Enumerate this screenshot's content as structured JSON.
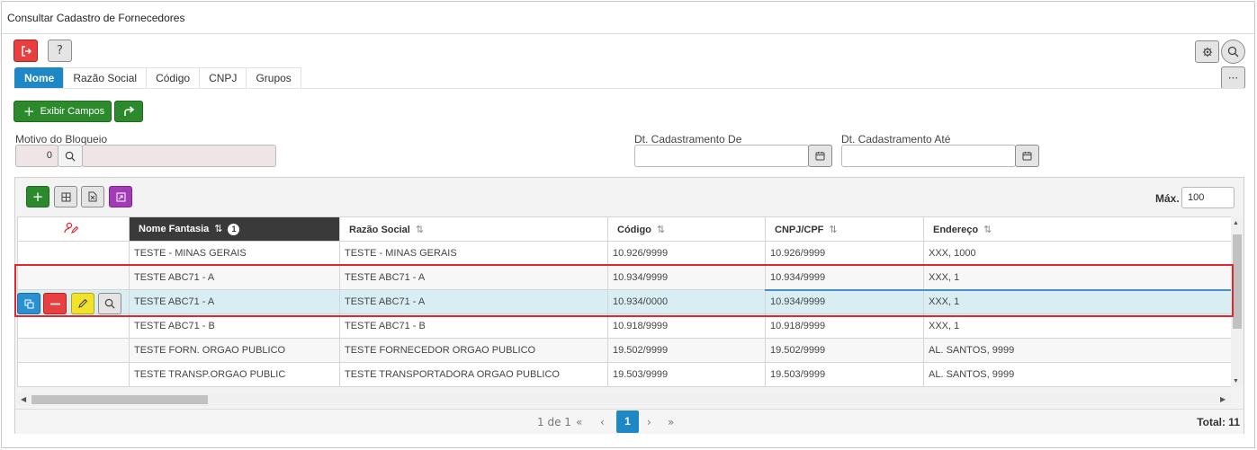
{
  "window": {
    "title": "Consultar Cadastro de Fornecedores"
  },
  "toolbar": {
    "exit_icon": "exit-icon",
    "help_label": "?",
    "settings_icon": "gear-icon",
    "search_icon": "search-icon",
    "more_label": "···"
  },
  "tabs": [
    {
      "label": "Nome",
      "active": true
    },
    {
      "label": "Razão Social"
    },
    {
      "label": "Código"
    },
    {
      "label": "CNPJ"
    },
    {
      "label": "Grupos"
    }
  ],
  "actions": {
    "show_fields_label": "Exibir Campos",
    "plus": "+",
    "share_icon": "share-icon"
  },
  "filters": {
    "motivo_label": "Motivo do Bloqueio",
    "motivo_code": "0",
    "dt_de_label": "Dt. Cadastramento De",
    "dt_ate_label": "Dt. Cadastramento Até"
  },
  "grid": {
    "max_label": "Máx.",
    "max_value": "100",
    "columns": [
      {
        "label": ""
      },
      {
        "label": "Nome Fantasia",
        "sort_rank": "1"
      },
      {
        "label": "Razão Social"
      },
      {
        "label": "Código"
      },
      {
        "label": "CNPJ/CPF"
      },
      {
        "label": "Endereço"
      }
    ],
    "rows": [
      {
        "nome": "TESTE - MINAS GERAIS",
        "razao": "TESTE - MINAS GERAIS",
        "codigo": "10.926/9999",
        "cnpj": "10.926/9999",
        "endereco": "XXX, 1000"
      },
      {
        "nome": "TESTE ABC71 - A",
        "razao": "TESTE ABC71 - A",
        "codigo": "10.934/9999",
        "cnpj": "10.934/9999",
        "endereco": "XXX, 1"
      },
      {
        "nome": "TESTE ABC71 - A",
        "razao": "TESTE ABC71 - A",
        "codigo": "10.934/0000",
        "cnpj": "10.934/9999",
        "endereco": "XXX, 1"
      },
      {
        "nome": "TESTE ABC71 - B",
        "razao": "TESTE ABC71 - B",
        "codigo": "10.918/9999",
        "cnpj": "10.918/9999",
        "endereco": "XXX, 1"
      },
      {
        "nome": "TESTE FORN. ORGAO PUBLICO",
        "razao": "TESTE FORNECEDOR ORGAO PUBLICO",
        "codigo": "19.502/9999",
        "cnpj": "19.502/9999",
        "endereco": "AL. SANTOS, 9999"
      },
      {
        "nome": "TESTE TRANSP.ORGAO PUBLIC",
        "razao": "TESTE TRANSPORTADORA ORGAO PUBLICO",
        "codigo": "19.503/9999",
        "cnpj": "19.503/9999",
        "endereco": "AL. SANTOS, 9999"
      },
      {
        "nome": "",
        "razao": "",
        "codigo": "",
        "cnpj": "",
        "endereco": ""
      }
    ]
  },
  "pager": {
    "info": "1 de 1",
    "first": "«",
    "prev": "‹",
    "page": "1",
    "next": "›",
    "last": "»",
    "total_label": "Total: 11"
  },
  "colors": {
    "accent": "#1e88c7",
    "danger": "#e84040",
    "success": "#2c8a2c",
    "highlight": "#e3262d"
  }
}
